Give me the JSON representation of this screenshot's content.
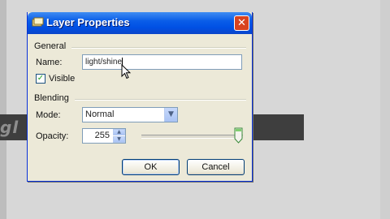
{
  "dialog": {
    "title": "Layer Properties",
    "close_glyph": "✕",
    "general_group": "General",
    "name_label": "Name:",
    "name_value": "light/shine",
    "visible_label": "Visible",
    "visible_checked": true,
    "checkbox_glyph": "✓",
    "blending_group": "Blending",
    "mode_label": "Mode:",
    "mode_value": "Normal",
    "dropdown_glyph": "▼",
    "opacity_label": "Opacity:",
    "opacity_value": "255",
    "spin_up_glyph": "▲",
    "spin_down_glyph": "▼",
    "opacity_slider_level": 1.0,
    "ok_label": "OK",
    "cancel_label": "Cancel"
  },
  "background": {
    "banner_text": "gl"
  },
  "colors": {
    "titlebar": "#0a5de8",
    "close_button": "#d9431f",
    "dialog_face": "#ece9d8",
    "banner": "#3e3e3e"
  },
  "icons": {
    "title_icon": "layer-icon",
    "cursor": "mouse-pointer-icon"
  }
}
